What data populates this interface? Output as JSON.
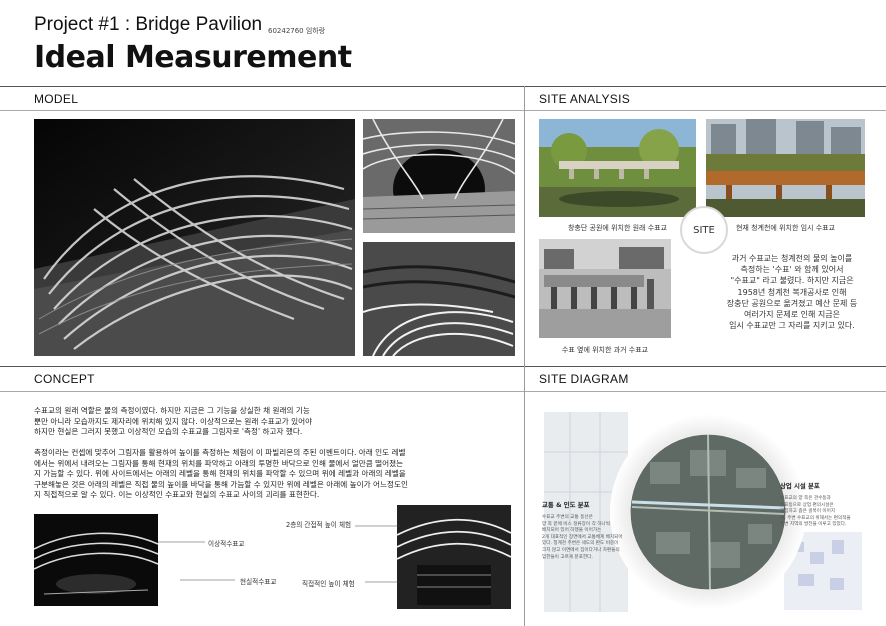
{
  "header": {
    "project_title": "Project #1 : Bridge Pavilion",
    "student_id": "60242760 임하랑",
    "main_title": "Ideal Measurement"
  },
  "sections": {
    "model": "MODEL",
    "site_analysis": "SITE ANALYSIS",
    "concept": "CONCEPT",
    "site_diagram": "SITE DIAGRAM"
  },
  "site_analysis": {
    "caption_1": "창충단 공원에 위치한 원래 수표교",
    "caption_2": "현재 청계천에 위치한 임시 수표교",
    "caption_3": "수표 옆에 위치한 과거 수표교",
    "badge": "SITE",
    "description": [
      "과거 수표교는 청계천의 물의 높이를",
      "측정하는 '수표' 와 함께 있어서",
      "\"수표교\" 라고 불렸다. 하지만 지금은",
      "1958년 청계천 복개공사로 인해",
      "장충단 공원으로 옮겨졌고 예산 문제 등",
      "여러가지 문제로 인해 지금은",
      "임시 수표교만 그 자리를 지키고 있다."
    ]
  },
  "concept": {
    "para1": [
      "수표교의 원래 역할은 물의 측정이였다. 하지만 지금은 그 기능을 상실한 채 원래의 기능",
      "뿐만 아니라 모습까지도 제자리에 위치해 있지 않다. 이상적으로는 원래 수표교가 있어야",
      "하지만 현실은 그러지 못했고 이상적인 모습의 수표교를 그림자로 '측정' 하고자 했다."
    ],
    "para2": [
      "측정이라는 컨셉에 맞추어 그림자를 활용하여 높이를 측정하는 체험이 이 파빌리온의 주된 이벤트이다. 아래 인도 레벨",
      "에서는 위에서 내려오는 그림자를 통해 현재의 위치를 파악하고 아래의 투명한 바닥으로 인해 물에서 얼만큼 떨어졌는",
      "지 가늠할 수 있다. 위에 사이트에서는 아래의 레벨을 통해 현재의 위치를 파악할 수 있으며 위에 레벨과 아래의 레벨을",
      "구분해놓은 것은 아래의 레벨은 직접 물의 높이를 바닥을 통해 가늠할 수 있지만 위에 레벨은 아래에 높이가 어느정도인",
      "지 직접적으로 알 수 있다. 이는 이상적인 수표교와 현실의 수표교 사이의 괴리를 표현한다."
    ],
    "labels": {
      "ideal": "이상적수표교",
      "real": "현실적수표교",
      "indirect": "2층의 간접적 높이 체험",
      "direct": "직접적인 높이 체험"
    }
  },
  "diagram": {
    "left_title": "교통 & 인도 분포",
    "left_text": [
      "수표교 주변의 교통 동선은",
      "양 쪽 끝에 비스 정류장이 각 하나씩",
      "배치되어 있어 하행을 이어가는",
      "2개 대표적인 장면에서 교통체계 배치되어",
      "있다. 청계천 주변은 세도의 판도 비중이",
      "크지 않고 이면에서 집이다거나 차편들의",
      "임한들이 고르게 분포한다."
    ],
    "right_title": "상업 시설 분포",
    "right_text": [
      "수표교의 양 쪽은 관수동과",
      "수표동으로 상업 편의시설은",
      "밀집하고 좁은 골목이 이어지",
      "며, 주변 수표교의 위해서는 편의적을",
      "주변 지역의 발전을 이루고 있었다."
    ]
  }
}
